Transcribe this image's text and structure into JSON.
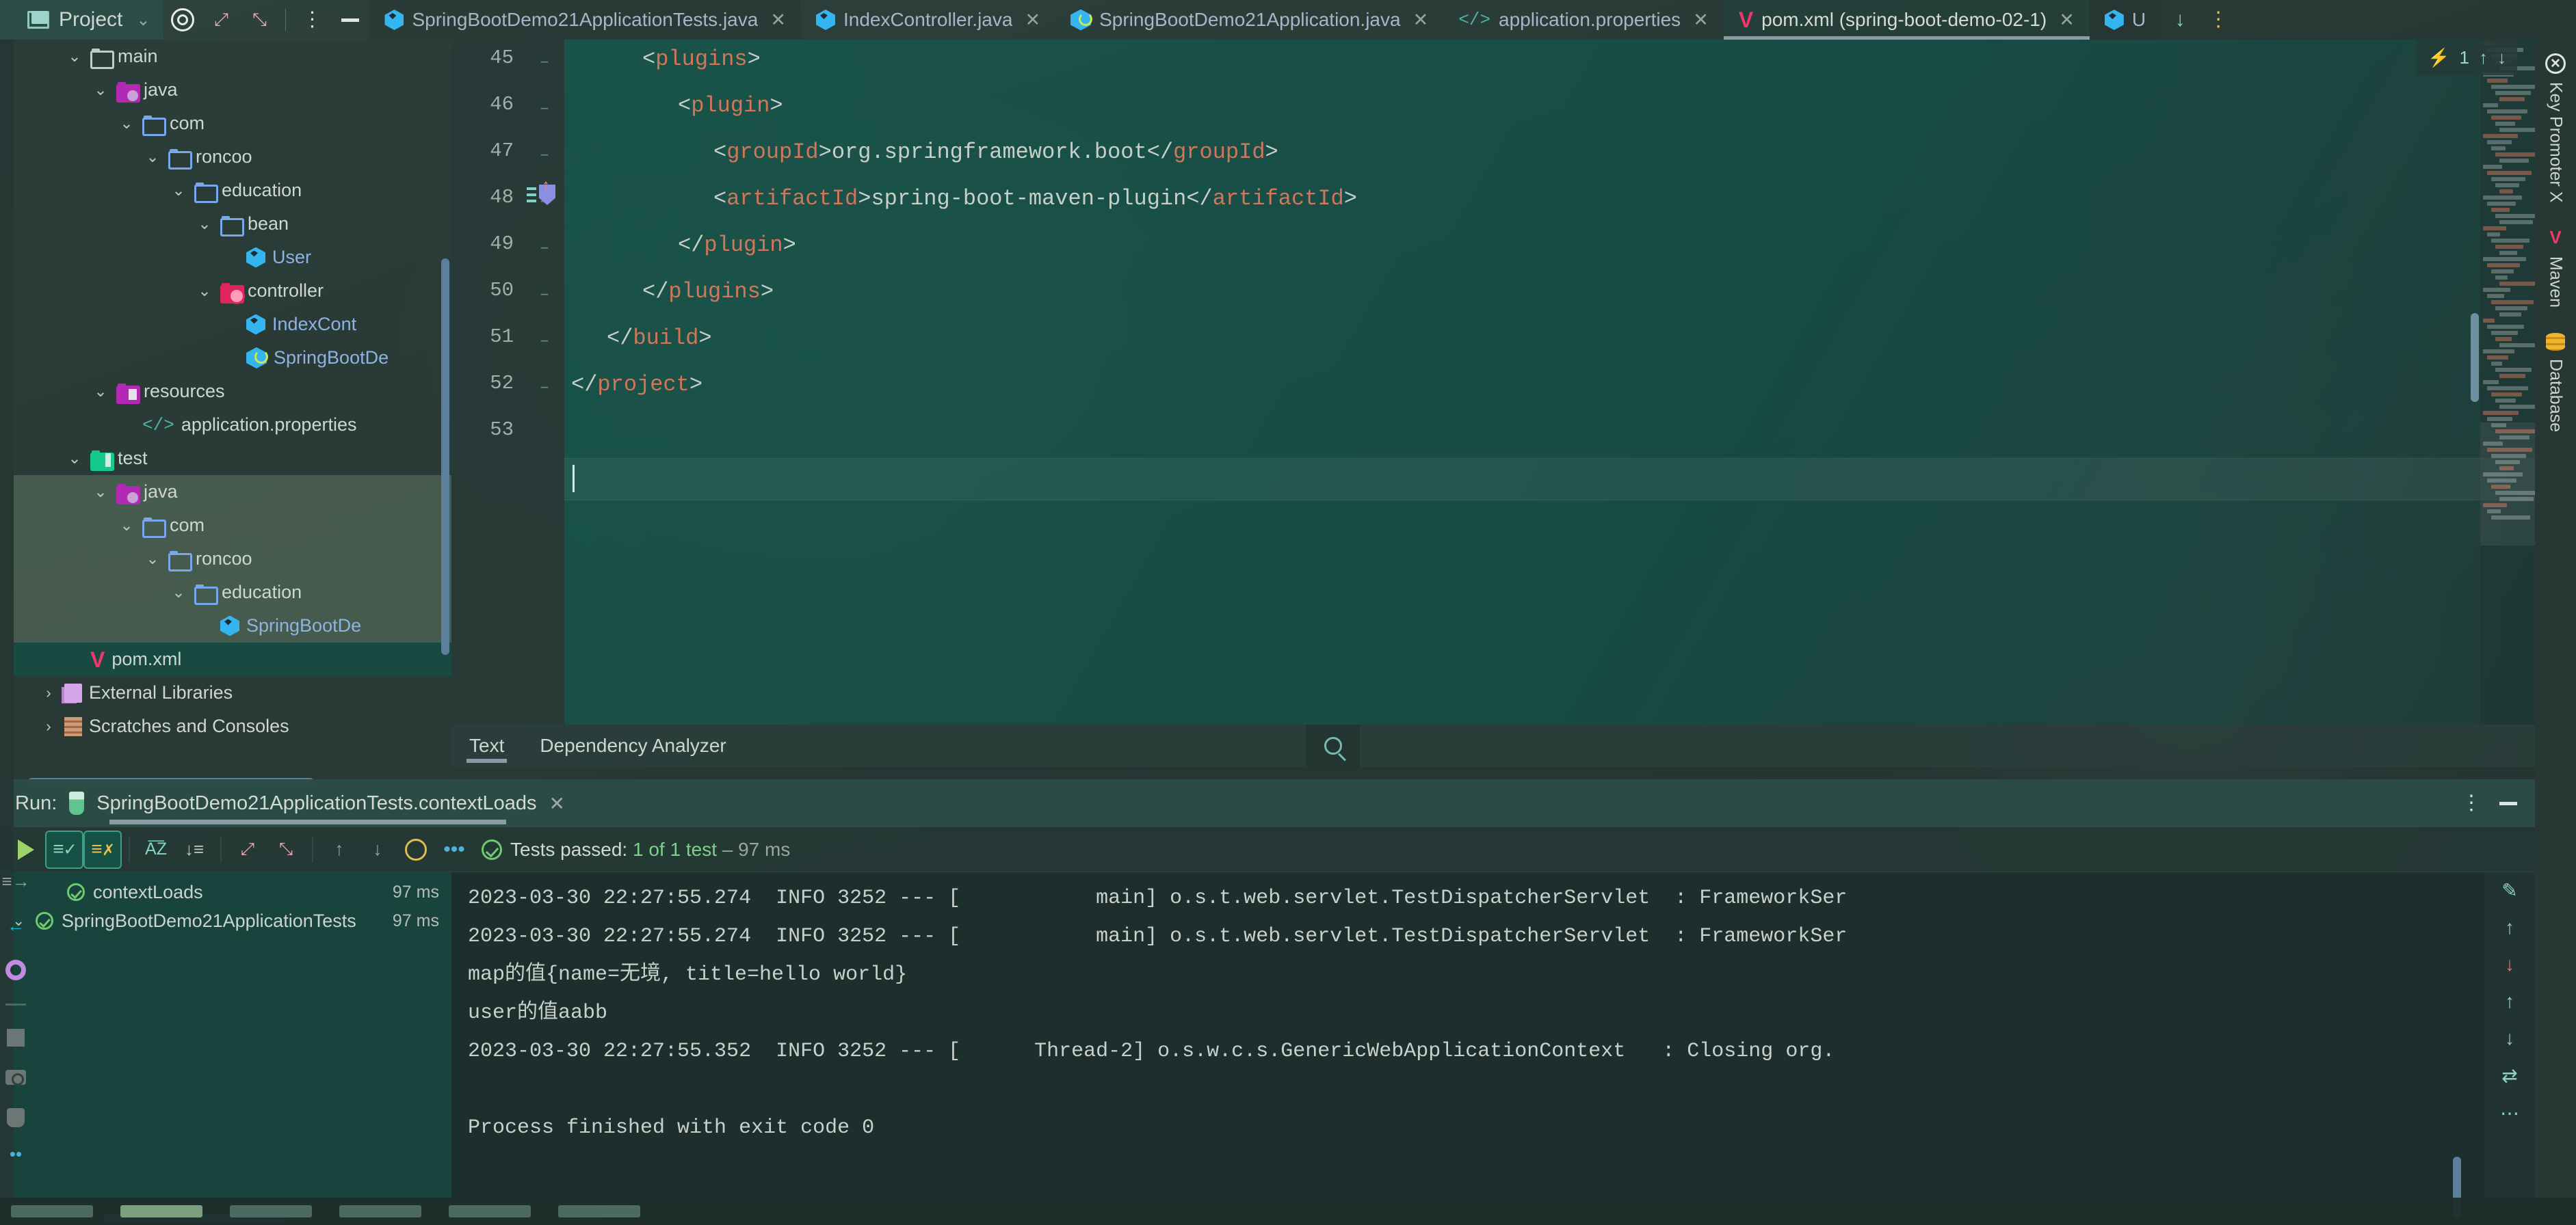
{
  "app": {
    "project_button": "Project",
    "window_controls": {
      "minimize": "—",
      "more": "⋮"
    }
  },
  "editor_tabs": [
    {
      "label": "SpringBootDemo21ApplicationTests.java",
      "icon": "java-class-icon",
      "close": "✕",
      "active": false
    },
    {
      "label": "IndexController.java",
      "icon": "java-class-icon",
      "close": "✕",
      "active": false
    },
    {
      "label": "SpringBootDemo21Application.java",
      "icon": "spring-boot-icon",
      "close": "✕",
      "active": false
    },
    {
      "label": "application.properties",
      "icon": "properties-icon",
      "close": "✕",
      "active": false
    },
    {
      "label": "pom.xml (spring-boot-demo-02-1)",
      "icon": "maven-icon",
      "close": "✕",
      "active": true
    },
    {
      "label": "U",
      "icon": "java-class-icon",
      "close": "",
      "active": false
    }
  ],
  "project_tree": [
    {
      "label": "main",
      "depth": 2,
      "arrow": "v",
      "icon": "folder-gray",
      "selected": "none"
    },
    {
      "label": "java",
      "depth": 3,
      "arrow": "v",
      "icon": "folder-java-source",
      "selected": "none"
    },
    {
      "label": "com",
      "depth": 4,
      "arrow": "v",
      "icon": "folder-blue",
      "selected": "none"
    },
    {
      "label": "roncoo",
      "depth": 5,
      "arrow": "v",
      "icon": "folder-blue",
      "selected": "none"
    },
    {
      "label": "education",
      "depth": 6,
      "arrow": "v",
      "icon": "folder-blue",
      "selected": "none"
    },
    {
      "label": "bean",
      "depth": 7,
      "arrow": "v",
      "icon": "folder-blue",
      "selected": "none"
    },
    {
      "label": "User",
      "depth": 8,
      "arrow": "",
      "icon": "java-class-icon",
      "selected": "none"
    },
    {
      "label": "controller",
      "depth": 7,
      "arrow": "v",
      "icon": "folder-controller",
      "selected": "none"
    },
    {
      "label": "IndexCont",
      "depth": 8,
      "arrow": "",
      "icon": "java-class-icon",
      "selected": "none"
    },
    {
      "label": "SpringBootDe",
      "depth": 8,
      "arrow": "",
      "icon": "spring-boot-icon",
      "selected": "none"
    },
    {
      "label": "resources",
      "depth": 3,
      "arrow": "v",
      "icon": "folder-resources",
      "selected": "none"
    },
    {
      "label": "application.properties",
      "depth": 4,
      "arrow": "",
      "icon": "properties-icon",
      "selected": "none"
    },
    {
      "label": "test",
      "depth": 2,
      "arrow": "v",
      "icon": "folder-test",
      "selected": "none"
    },
    {
      "label": "java",
      "depth": 3,
      "arrow": "v",
      "icon": "folder-java-source",
      "selected": "soft"
    },
    {
      "label": "com",
      "depth": 4,
      "arrow": "v",
      "icon": "folder-blue",
      "selected": "soft"
    },
    {
      "label": "roncoo",
      "depth": 5,
      "arrow": "v",
      "icon": "folder-blue",
      "selected": "soft"
    },
    {
      "label": "education",
      "depth": 6,
      "arrow": "v",
      "icon": "folder-blue",
      "selected": "soft"
    },
    {
      "label": "SpringBootDe",
      "depth": 7,
      "arrow": "",
      "icon": "java-class-icon",
      "selected": "soft"
    },
    {
      "label": "pom.xml",
      "depth": 2,
      "arrow": "",
      "icon": "maven-icon",
      "selected": "hard"
    },
    {
      "label": "External Libraries",
      "depth": 1,
      "arrow": ">",
      "icon": "library-icon",
      "selected": "none"
    },
    {
      "label": "Scratches and Consoles",
      "depth": 1,
      "arrow": ">",
      "icon": "scratches-icon",
      "selected": "none"
    }
  ],
  "editor": {
    "filetype": "xml",
    "inspection_count": "1",
    "lines": [
      {
        "num": "45",
        "indent": 2,
        "text": "<plugins>"
      },
      {
        "num": "46",
        "indent": 3,
        "text": "<plugin>"
      },
      {
        "num": "47",
        "indent": 4,
        "text": "<groupId>org.springframework.boot</groupId>"
      },
      {
        "num": "48",
        "indent": 4,
        "text": "<artifactId>spring-boot-maven-plugin</artifactId>"
      },
      {
        "num": "49",
        "indent": 3,
        "text": "</plugin>"
      },
      {
        "num": "50",
        "indent": 2,
        "text": "</plugins>"
      },
      {
        "num": "51",
        "indent": 1,
        "text": "</build>"
      },
      {
        "num": "52",
        "indent": 0,
        "text": "</project>"
      },
      {
        "num": "53",
        "indent": 0,
        "text": ""
      }
    ]
  },
  "analyzer_bar": {
    "tabs": [
      {
        "label": "Text",
        "active": true
      },
      {
        "label": "Dependency Analyzer",
        "active": false
      }
    ],
    "search_icon": "search-icon"
  },
  "run_window": {
    "title": "Run:",
    "config_name": "SpringBootDemo21ApplicationTests.contextLoads",
    "close": "✕",
    "more": "⋮",
    "minimize": "—",
    "status": {
      "prefix": "Tests passed: ",
      "count": "1",
      "of": " of ",
      "total": "1 test",
      "duration": " – 97 ms"
    },
    "toolbar_icons": [
      "rerun-icon",
      "show-passed-icon",
      "hide-ignored-icon",
      "sort-alphabetically-icon",
      "sort-duration-icon",
      "expand-all-icon",
      "collapse-all-icon",
      "prev-failed-icon",
      "next-failed-icon",
      "history-icon",
      "more-options-icon"
    ],
    "test_tree": [
      {
        "label": "SpringBootDemo21ApplicationTests",
        "time": "97 ms",
        "depth": 0,
        "arrow": "v",
        "status": "passed"
      },
      {
        "label": "contextLoads",
        "time": "97 ms",
        "depth": 1,
        "arrow": "",
        "status": "passed"
      }
    ],
    "console_lines": [
      "2023-03-30 22:27:55.274  INFO 3252 --- [           main] o.s.t.web.servlet.TestDispatcherServlet  : FrameworkSer",
      "2023-03-30 22:27:55.274  INFO 3252 --- [           main] o.s.t.web.servlet.TestDispatcherServlet  : FrameworkSer",
      "map的值{name=无境, title=hello world}",
      "user的值aabb",
      "2023-03-30 22:27:55.352  INFO 3252 --- [      Thread-2] o.s.w.c.s.GenericWebApplicationContext   : Closing org.",
      "",
      "Process finished with exit code 0"
    ],
    "side_icons": [
      "edit-icon",
      "up-arrow-icon",
      "down-arrow-icon",
      "soft-wrap-icon",
      "more-icon"
    ]
  },
  "right_toolwindows": [
    {
      "label": "Key Promoter X",
      "icon": "key-promoter-icon"
    },
    {
      "label": "Maven",
      "icon": "maven-icon"
    },
    {
      "label": "Database",
      "icon": "database-icon"
    }
  ],
  "left_rail_icons": [
    "structure-icon",
    "import-icon",
    "settings-icon",
    "stop-icon",
    "screenshot-icon",
    "plugin-icon",
    "more-dots-icon"
  ],
  "colors": {
    "accent_teal": "#8ed1c4",
    "tag_orange": "#d2765a",
    "pass_green": "#6fc96f",
    "maven_pink": "#f2366b",
    "java_blue": "#34b5f0",
    "selection_green": "#6d8b70"
  }
}
